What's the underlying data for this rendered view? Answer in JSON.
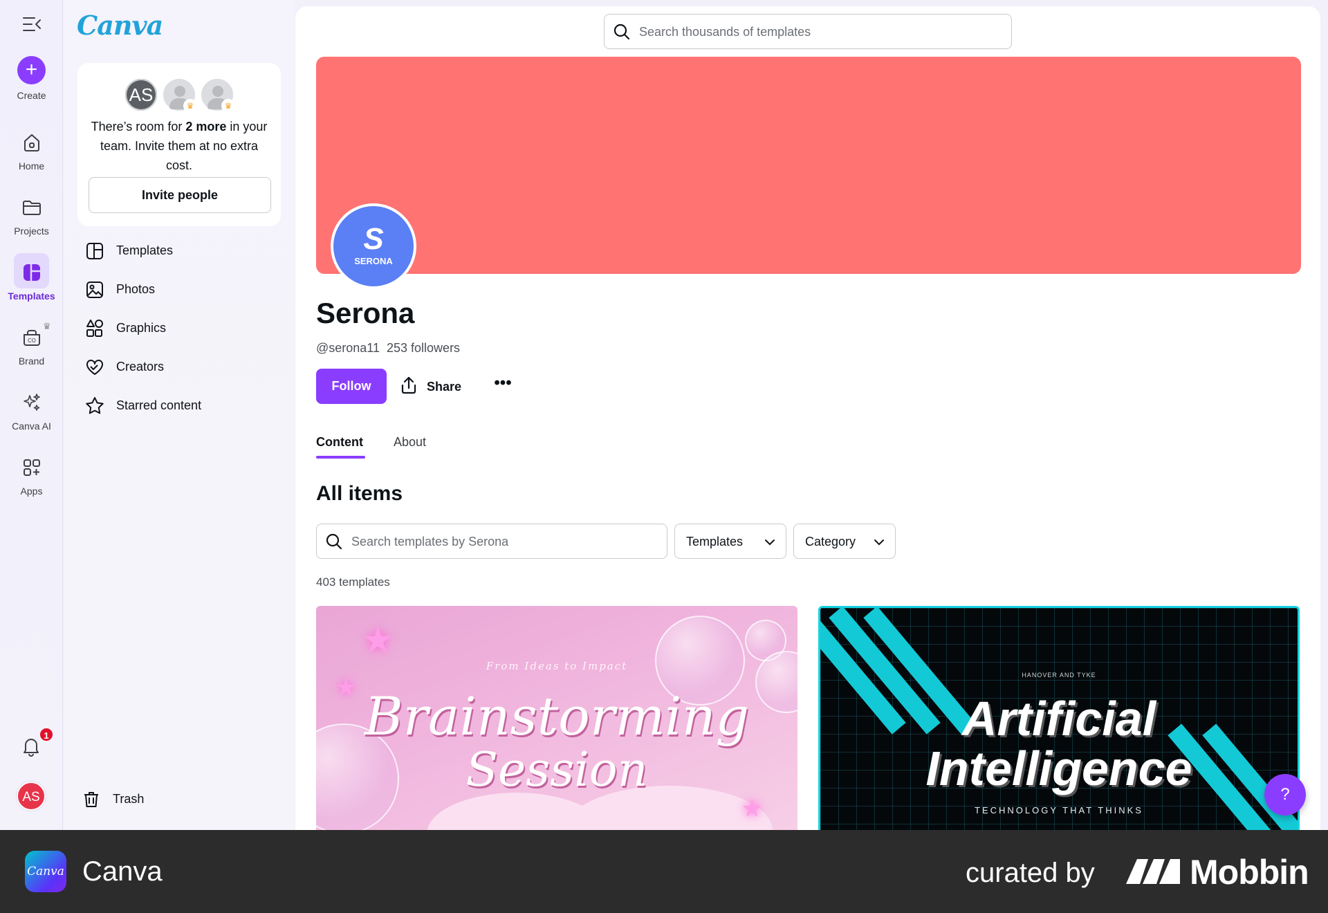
{
  "app": {
    "logo_text": "Canva"
  },
  "rail": {
    "create_label": "Create",
    "items": [
      {
        "label": "Home",
        "icon": "home-icon"
      },
      {
        "label": "Projects",
        "icon": "folder-icon"
      },
      {
        "label": "Templates",
        "icon": "templates-icon",
        "active": true
      },
      {
        "label": "Brand",
        "icon": "brand-icon"
      },
      {
        "label": "Canva AI",
        "icon": "sparkle-icon"
      },
      {
        "label": "Apps",
        "icon": "apps-icon"
      }
    ],
    "notification_count": "1",
    "user_initials": "AS"
  },
  "team_card": {
    "owner_initials": "AS",
    "text_before": "There’s room for ",
    "text_bold": "2 more",
    "text_after": " in your team. Invite them at no extra cost.",
    "invite_label": "Invite people"
  },
  "sidebar": {
    "items": [
      {
        "label": "Templates",
        "icon": "template-layout-icon"
      },
      {
        "label": "Photos",
        "icon": "photo-icon"
      },
      {
        "label": "Graphics",
        "icon": "shapes-icon"
      },
      {
        "label": "Creators",
        "icon": "heart-hands-icon"
      },
      {
        "label": "Starred content",
        "icon": "star-icon"
      }
    ],
    "trash_label": "Trash"
  },
  "search": {
    "placeholder": "Search thousands of templates"
  },
  "profile": {
    "banner_color": "#ff7373",
    "logo_mark": "S",
    "logo_text": "SERONA",
    "name": "Serona",
    "handle": "@serona11",
    "followers": "253 followers",
    "follow_label": "Follow",
    "share_label": "Share",
    "more_label": "•••"
  },
  "tabs": [
    {
      "label": "Content",
      "active": true
    },
    {
      "label": "About",
      "active": false
    }
  ],
  "content": {
    "section_title": "All items",
    "search_placeholder": "Search templates by Serona",
    "filter_type": "Templates",
    "filter_category": "Category",
    "count": "403 templates"
  },
  "cards": [
    {
      "subtitle": "From Ideas to Impact",
      "title_line1": "Brainstorming",
      "title_line2": "Session"
    },
    {
      "kicker": "HANOVER AND TYKE",
      "title_line1": "Artificial",
      "title_line2": "Intelligence",
      "tagline": "TECHNOLOGY THAT THINKS"
    }
  ],
  "help_label": "?",
  "footer": {
    "app_icon_text": "Canva",
    "app_name": "Canva",
    "curated_by": "curated by",
    "brand": "Mobbin"
  },
  "colors": {
    "accent": "#8b3dff",
    "banner": "#ff7373",
    "notification": "#e1112b"
  }
}
